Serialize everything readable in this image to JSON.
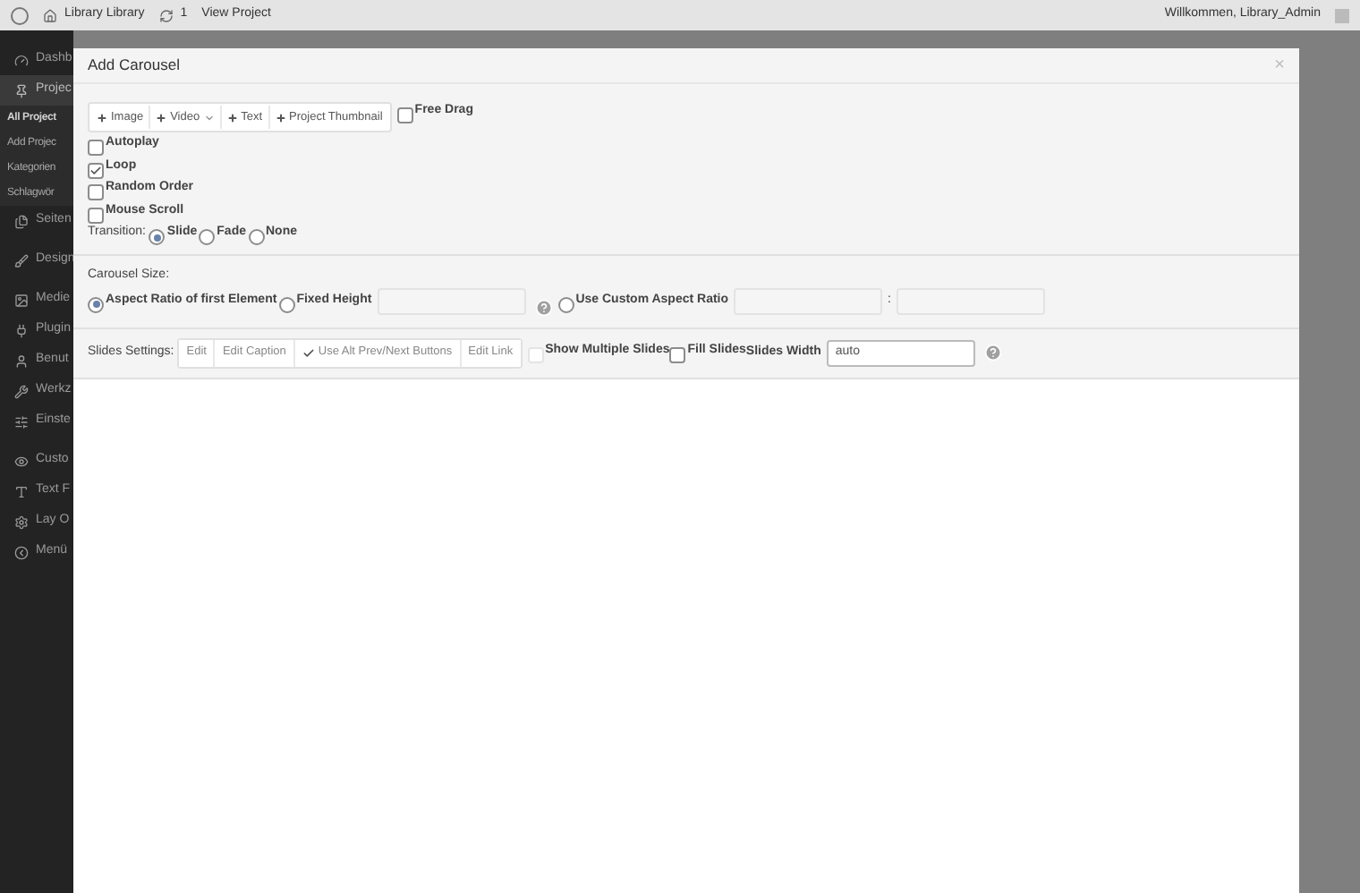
{
  "admin_bar": {
    "site": "Library Library",
    "updates": "1",
    "view": "View Project",
    "greeting": "Willkommen, Library_Admin"
  },
  "sidebar": {
    "items": [
      {
        "label": "Dashb",
        "kind": "top",
        "selected": false
      },
      {
        "label": "Projec",
        "kind": "top",
        "selected": true
      },
      {
        "label": "All Project",
        "kind": "sub",
        "selected": true
      },
      {
        "label": "Add Projec",
        "kind": "sub",
        "selected": false
      },
      {
        "label": "Kategorien",
        "kind": "sub",
        "selected": false
      },
      {
        "label": "Schlagwör",
        "kind": "sub",
        "selected": false
      },
      {
        "label": "Seiten",
        "kind": "top",
        "selected": false
      },
      {
        "label": "Design",
        "kind": "top",
        "selected": false
      },
      {
        "label": "Medie",
        "kind": "top",
        "selected": false
      },
      {
        "label": "Plugin",
        "kind": "top",
        "selected": false
      },
      {
        "label": "Benut",
        "kind": "top",
        "selected": false
      },
      {
        "label": "Werkz",
        "kind": "top",
        "selected": false
      },
      {
        "label": "Einste",
        "kind": "top",
        "selected": false
      },
      {
        "label": "Custo",
        "kind": "top",
        "selected": false
      },
      {
        "label": "Text F",
        "kind": "top",
        "selected": false
      },
      {
        "label": "Lay O",
        "kind": "top",
        "selected": false
      },
      {
        "label": "Menü",
        "kind": "top",
        "selected": false
      }
    ]
  },
  "modal": {
    "title": "Add Carousel",
    "close": "×",
    "add_buttons": [
      {
        "label": "Image",
        "kind": "plain"
      },
      {
        "label": "Video",
        "kind": "dropdown"
      },
      {
        "label": "Text",
        "kind": "plain"
      },
      {
        "label": "Project Thumbnail",
        "kind": "plain"
      }
    ],
    "free_drag": {
      "label": "Free Drag",
      "checked": false
    },
    "options": [
      {
        "label": "Autoplay",
        "checked": false
      },
      {
        "label": "Loop",
        "checked": true
      },
      {
        "label": "Random Order",
        "checked": false
      },
      {
        "label": "Mouse Scroll",
        "checked": false
      }
    ],
    "transition": {
      "label": "Transition:",
      "choices": [
        {
          "label": "Slide",
          "selected": true
        },
        {
          "label": "Fade",
          "selected": false
        },
        {
          "label": "None",
          "selected": false
        }
      ]
    },
    "carousel_size": {
      "label": "Carousel Size:",
      "aspect_first": {
        "label": "Aspect Ratio of first Element",
        "selected": true
      },
      "fixed_height": {
        "label": "Fixed Height",
        "selected": false
      },
      "custom_ratio": {
        "label": "Use Custom Aspect Ratio",
        "selected": false
      },
      "separator": ":"
    },
    "slides_settings": {
      "label": "Slides Settings:",
      "buttons": [
        {
          "label": "Edit",
          "checked": false
        },
        {
          "label": "Edit Caption",
          "checked": false
        },
        {
          "label": "Use Alt Prev/Next Buttons",
          "checked": true
        },
        {
          "label": "Edit Link",
          "checked": false
        }
      ],
      "show_multiple": {
        "label": "Show Multiple Slides",
        "checked": false
      },
      "fill_slides": {
        "label": "Fill Slides",
        "checked": false
      },
      "width_label": "Slides Width",
      "width_value": "auto"
    }
  }
}
